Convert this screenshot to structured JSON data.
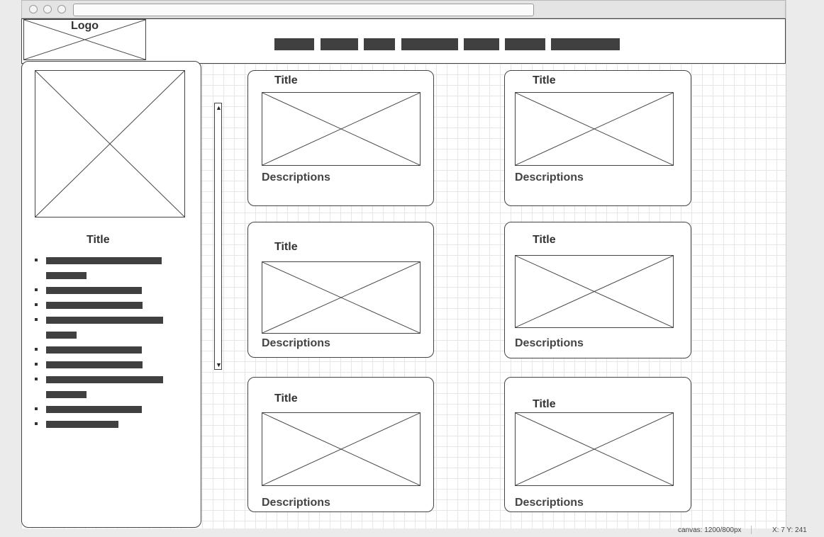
{
  "header": {
    "logo_label": "Logo"
  },
  "nav": {
    "items": [
      "",
      "",
      "",
      "",
      "",
      "",
      ""
    ]
  },
  "sidebar": {
    "title": "Title"
  },
  "cards": [
    {
      "title": "Title",
      "description": "Descriptions"
    },
    {
      "title": "Title",
      "description": "Descriptions"
    },
    {
      "title": "Title",
      "description": "Descriptions"
    },
    {
      "title": "Title",
      "description": "Descriptions"
    },
    {
      "title": "Title",
      "description": "Descriptions"
    },
    {
      "title": "Title",
      "description": "Descriptions"
    }
  ],
  "scrollbar": {
    "up_arrow": "▲",
    "down_arrow": "▼"
  },
  "status": {
    "canvas": "canvas: 1200/800px",
    "coords": "X: 7 Y: 241"
  },
  "icons": {
    "placeholder": "image-placeholder-icon"
  },
  "colors": {
    "ink": "#404040",
    "grid": "#e6e6e6",
    "chrome": "#e4e4e4"
  }
}
